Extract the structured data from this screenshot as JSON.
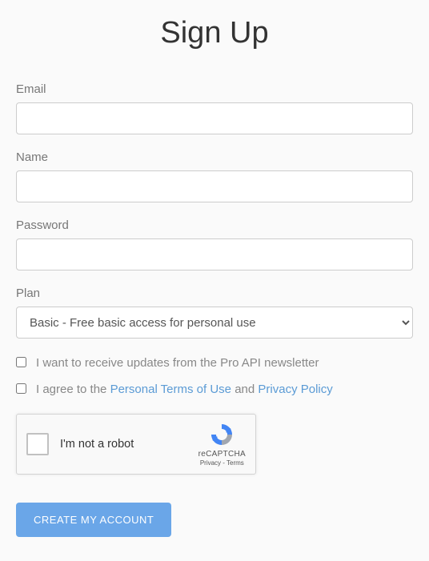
{
  "title": "Sign Up",
  "fields": {
    "email": {
      "label": "Email",
      "value": ""
    },
    "name": {
      "label": "Name",
      "value": ""
    },
    "password": {
      "label": "Password",
      "value": ""
    },
    "plan": {
      "label": "Plan",
      "selected": "Basic - Free basic access for personal use"
    }
  },
  "checkboxes": {
    "newsletter": {
      "label": "I want to receive updates from the Pro API newsletter",
      "checked": false
    },
    "terms": {
      "prefix": "I agree to the ",
      "link1": "Personal Terms of Use",
      "middle": " and ",
      "link2": "Privacy Policy",
      "checked": false
    }
  },
  "recaptcha": {
    "text": "I'm not a robot",
    "brand": "reCAPTCHA",
    "links": "Privacy - Terms"
  },
  "submit": {
    "label": "CREATE MY ACCOUNT"
  }
}
